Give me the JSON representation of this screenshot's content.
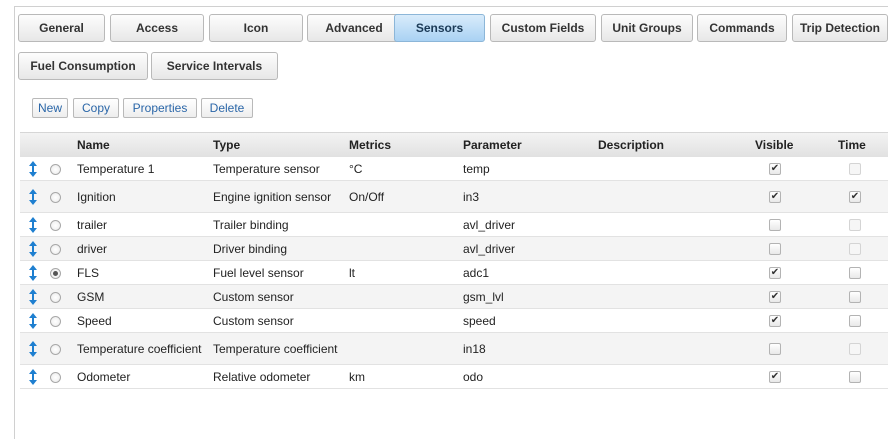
{
  "tabs": [
    {
      "label": "General",
      "active": false
    },
    {
      "label": "Access",
      "active": false
    },
    {
      "label": "Icon",
      "active": false
    },
    {
      "label": "Advanced",
      "active": false
    },
    {
      "label": "Sensors",
      "active": true
    },
    {
      "label": "Custom Fields",
      "active": false
    },
    {
      "label": "Unit Groups",
      "active": false
    },
    {
      "label": "Commands",
      "active": false
    },
    {
      "label": "Trip Detection",
      "active": false
    },
    {
      "label": "Fuel Consumption",
      "active": false
    },
    {
      "label": "Service Intervals",
      "active": false
    }
  ],
  "toolbar": {
    "new_label": "New",
    "copy_label": "Copy",
    "properties_label": "Properties",
    "delete_label": "Delete"
  },
  "table": {
    "columns": [
      "Name",
      "Type",
      "Metrics",
      "Parameter",
      "Description",
      "Visible",
      "Time"
    ],
    "rows": [
      {
        "name": "Temperature 1",
        "type": "Temperature sensor",
        "metrics": "°C",
        "parameter": "temp",
        "description": "",
        "visible": true,
        "time": false,
        "time_enabled": false,
        "selected": false
      },
      {
        "name": "Ignition",
        "type": "Engine ignition sensor",
        "metrics": "On/Off",
        "parameter": "in3",
        "description": "",
        "visible": true,
        "time": true,
        "time_enabled": true,
        "selected": false
      },
      {
        "name": "trailer",
        "type": "Trailer binding",
        "metrics": "",
        "parameter": "avl_driver",
        "description": "",
        "visible": false,
        "time": false,
        "time_enabled": false,
        "selected": false
      },
      {
        "name": "driver",
        "type": "Driver binding",
        "metrics": "",
        "parameter": "avl_driver",
        "description": "",
        "visible": false,
        "time": false,
        "time_enabled": false,
        "selected": false
      },
      {
        "name": "FLS",
        "type": "Fuel level sensor",
        "metrics": "lt",
        "parameter": "adc1",
        "description": "",
        "visible": true,
        "time": false,
        "time_enabled": true,
        "selected": true
      },
      {
        "name": "GSM",
        "type": "Custom sensor",
        "metrics": "",
        "parameter": "gsm_lvl",
        "description": "",
        "visible": true,
        "time": false,
        "time_enabled": true,
        "selected": false
      },
      {
        "name": "Speed",
        "type": "Custom sensor",
        "metrics": "",
        "parameter": "speed",
        "description": "",
        "visible": true,
        "time": false,
        "time_enabled": true,
        "selected": false
      },
      {
        "name": "Temperature coefficient",
        "type": "Temperature coefficient",
        "metrics": "",
        "parameter": "in18",
        "description": "",
        "visible": false,
        "time": false,
        "time_enabled": false,
        "selected": false
      },
      {
        "name": "Odometer",
        "type": "Relative odometer",
        "metrics": "km",
        "parameter": "odo",
        "description": "",
        "visible": true,
        "time": false,
        "time_enabled": true,
        "selected": false
      }
    ]
  },
  "colors": {
    "active_tab": "#a9d2f3",
    "link_text": "#2a66a8",
    "drag_icon": "#1e7fd0"
  },
  "icons": {
    "drag_handle": "vertical-double-arrow",
    "checked": "check-mark"
  }
}
